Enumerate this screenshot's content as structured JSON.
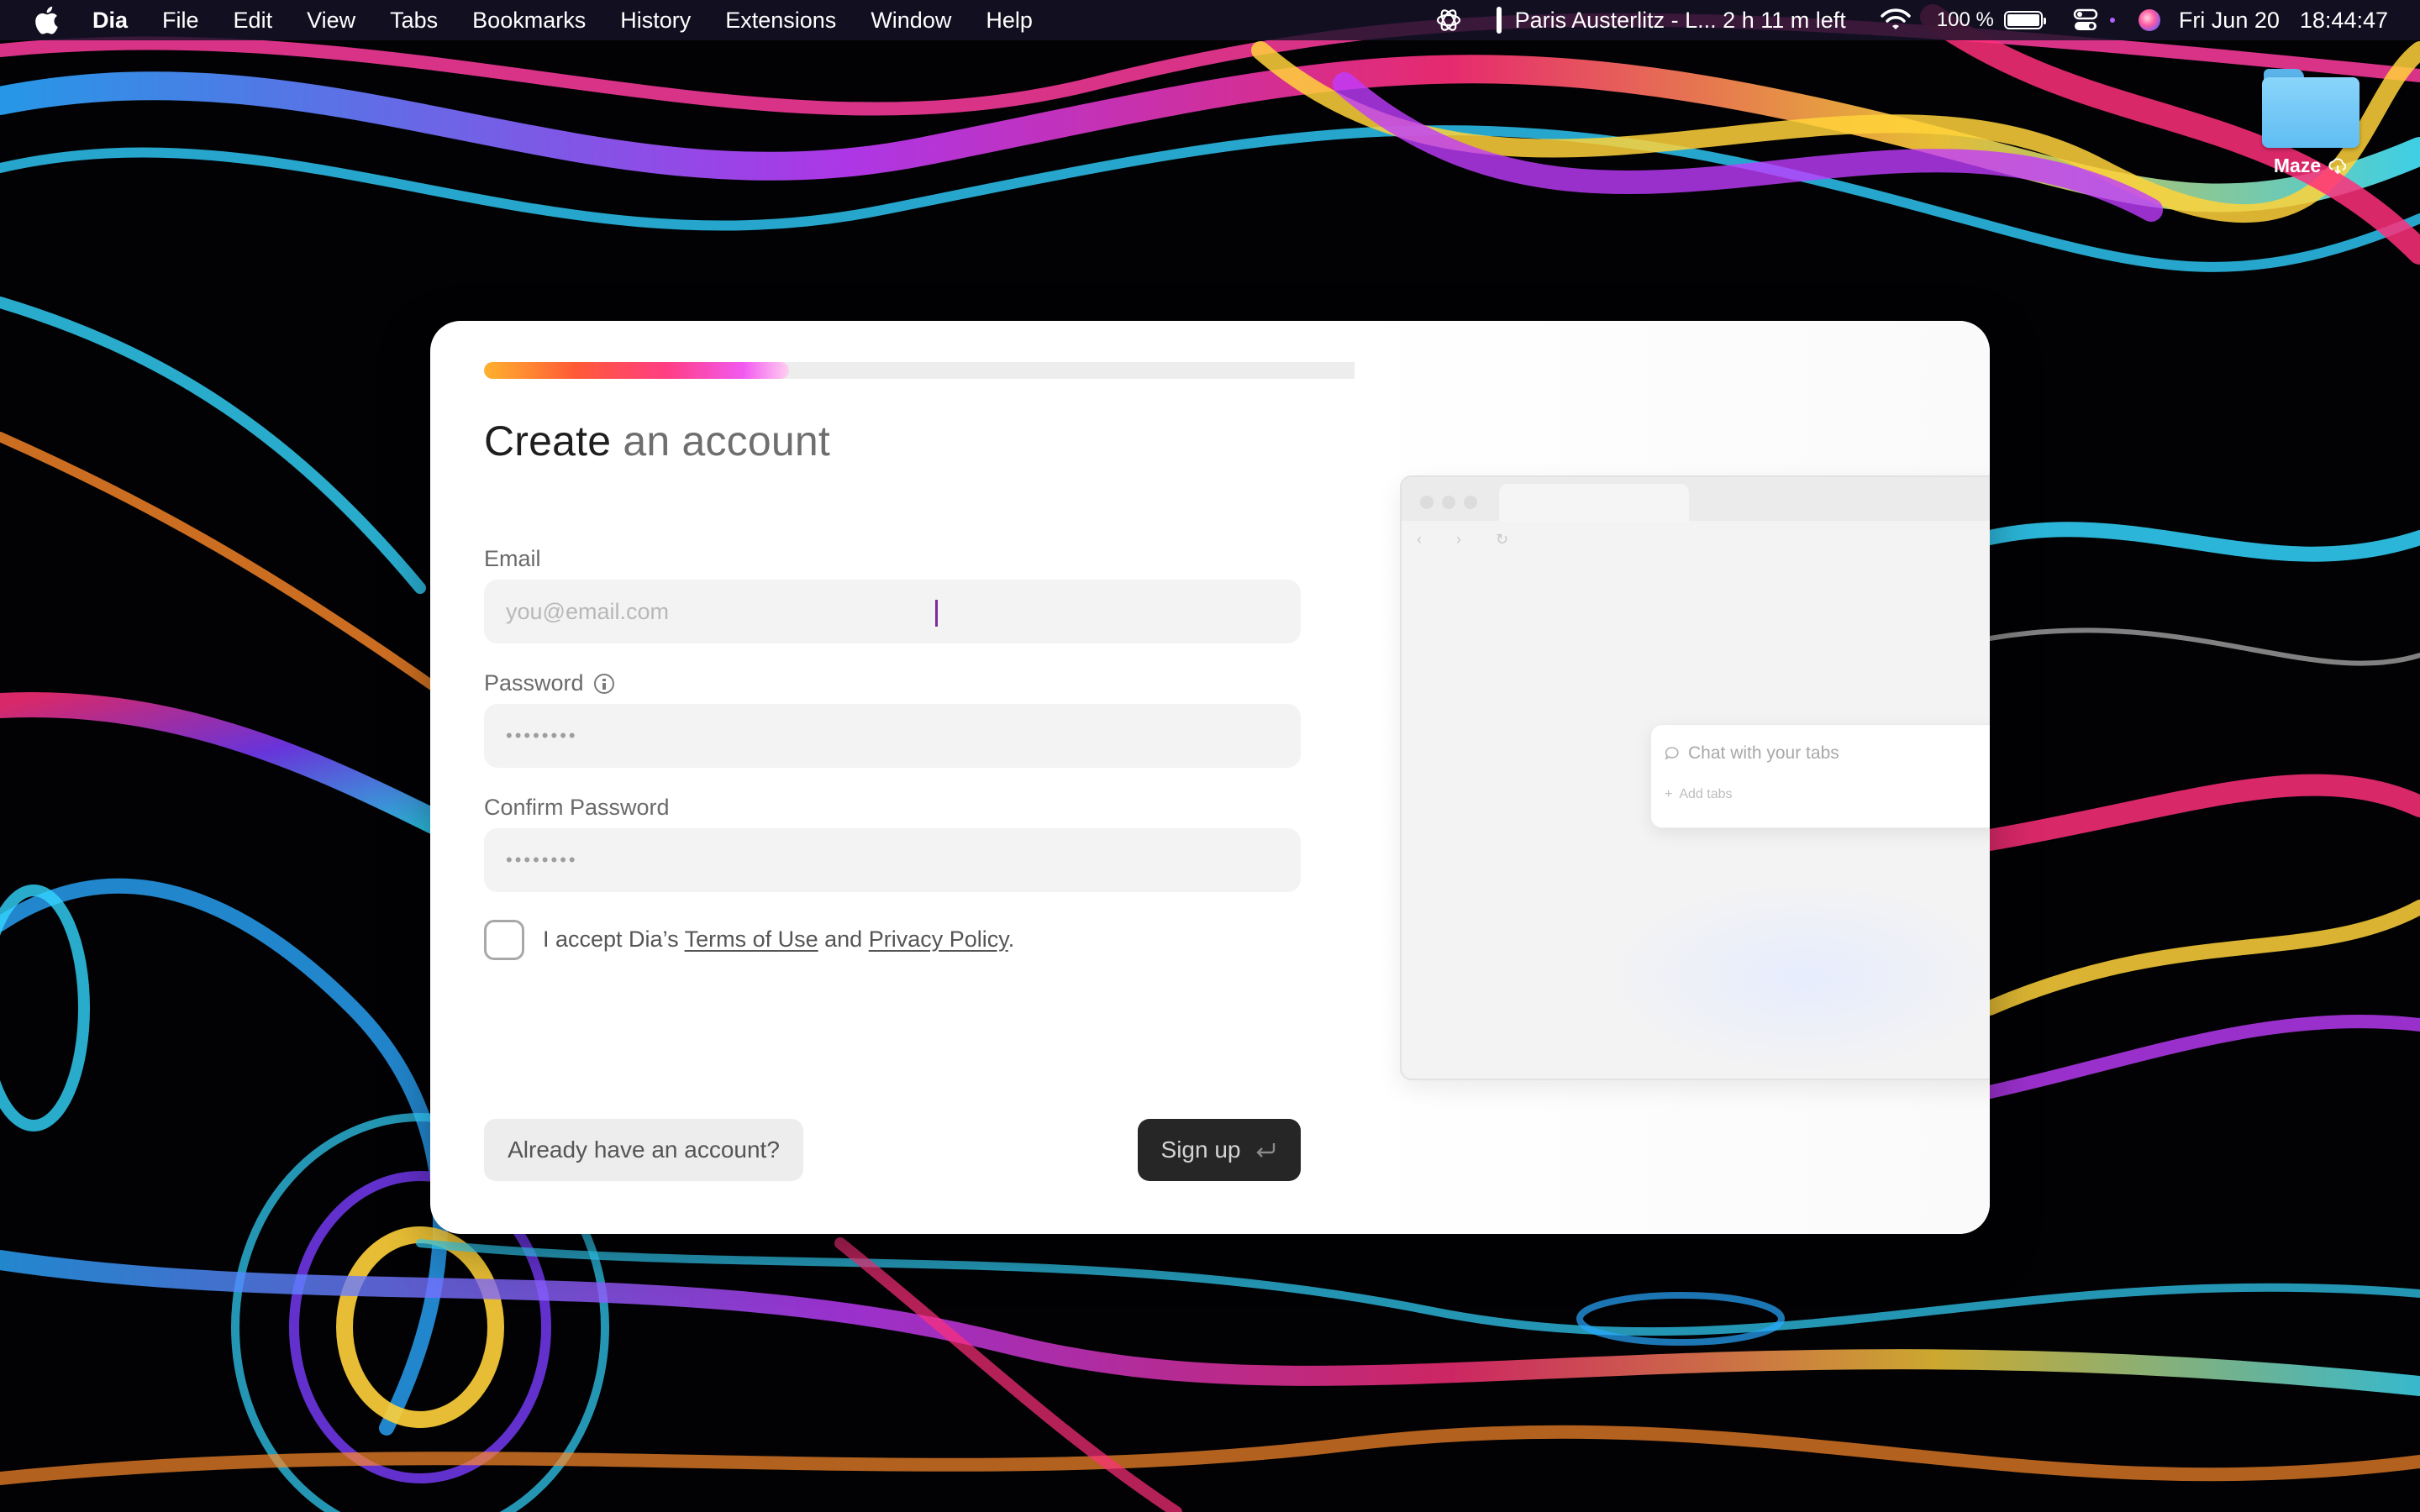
{
  "menubar": {
    "app_name": "Dia",
    "items": [
      "File",
      "Edit",
      "View",
      "Tabs",
      "Bookmarks",
      "History",
      "Extensions",
      "Window",
      "Help"
    ],
    "now_playing": "Paris Austerlitz - L... 2 h 11 m left",
    "battery_percent": "100 %",
    "battery_level": 1.0,
    "date": "Fri Jun 20",
    "time": "18:44:47"
  },
  "desktop": {
    "folder_label": "Maze"
  },
  "dialog": {
    "progress": 0.21,
    "title_main": "Create",
    "title_rest": " an account",
    "email": {
      "label": "Email",
      "placeholder": "you@email.com",
      "value": ""
    },
    "password": {
      "label": "Password",
      "dots": "••••••••"
    },
    "confirm_password": {
      "label": "Confirm Password",
      "dots": "••••••••"
    },
    "consent": {
      "prefix": "I accept Dia’s ",
      "terms": "Terms of Use",
      "middle": " and ",
      "privacy": "Privacy Policy",
      "suffix": ".",
      "checked": false
    },
    "secondary_button": "Already have an account?",
    "primary_button": "Sign up",
    "preview": {
      "chat_placeholder": "Chat with your tabs",
      "add_tabs": "Add tabs"
    }
  },
  "colors": {
    "accent_gradient": [
      "#ffb12e",
      "#ff5a36",
      "#ff3d84",
      "#f25af0"
    ],
    "primary_button_bg": "#262626",
    "caret": "#7d2a9a"
  }
}
